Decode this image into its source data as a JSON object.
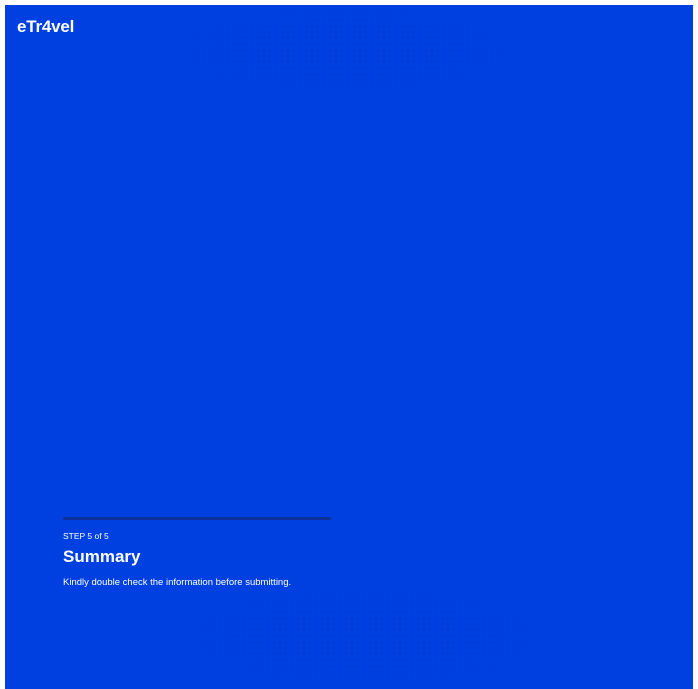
{
  "brand": {
    "logo_text": "eTr4vel"
  },
  "step": {
    "label": "STEP 5 of 5",
    "progress": 1.0,
    "title": "Summary",
    "description": "Kindly double check the information before submitting."
  },
  "colors": {
    "background": "#0040e0",
    "progress_track": "#0f2f99",
    "text": "#ffffff"
  }
}
